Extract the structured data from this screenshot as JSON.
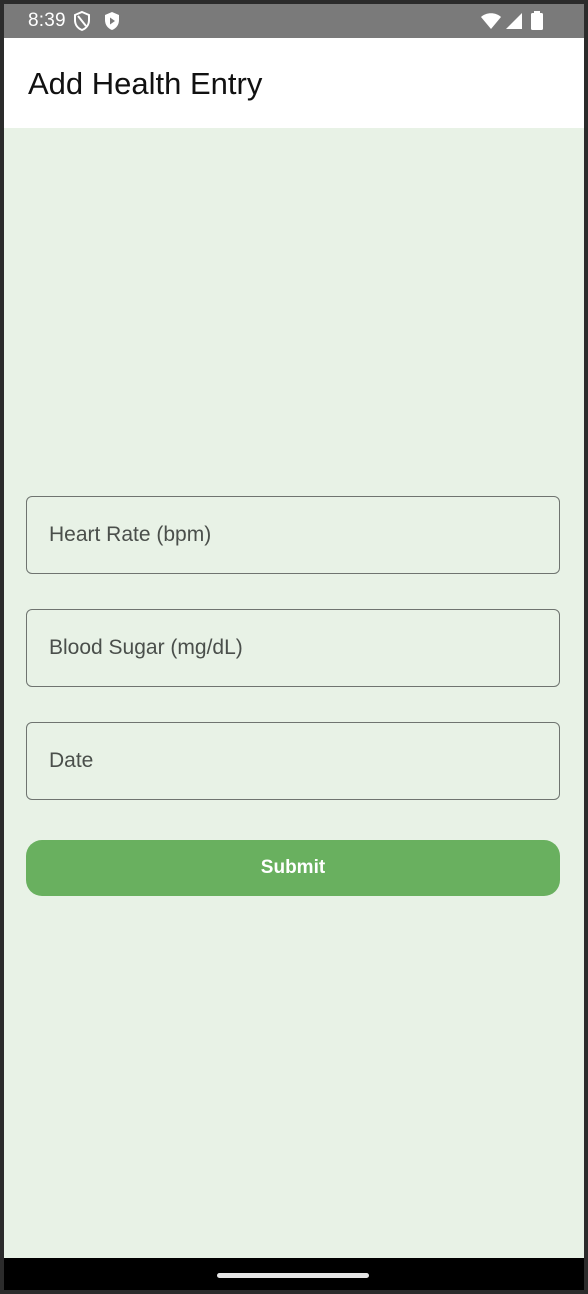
{
  "status_bar": {
    "time": "8:39",
    "left_icons": [
      "shield-outline-icon",
      "play-shield-icon"
    ],
    "right_icons": [
      "wifi-icon",
      "cell-signal-icon",
      "battery-icon"
    ]
  },
  "app_bar": {
    "title": "Add Health Entry"
  },
  "form": {
    "heart_rate": {
      "placeholder": "Heart Rate (bpm)",
      "value": ""
    },
    "blood_sugar": {
      "placeholder": "Blood Sugar (mg/dL)",
      "value": ""
    },
    "date": {
      "placeholder": "Date",
      "value": ""
    },
    "submit_label": "Submit"
  },
  "colors": {
    "background": "#e8f2e6",
    "accent": "#69b05f",
    "status_bar": "#7a7a7a",
    "app_bar": "#ffffff"
  }
}
